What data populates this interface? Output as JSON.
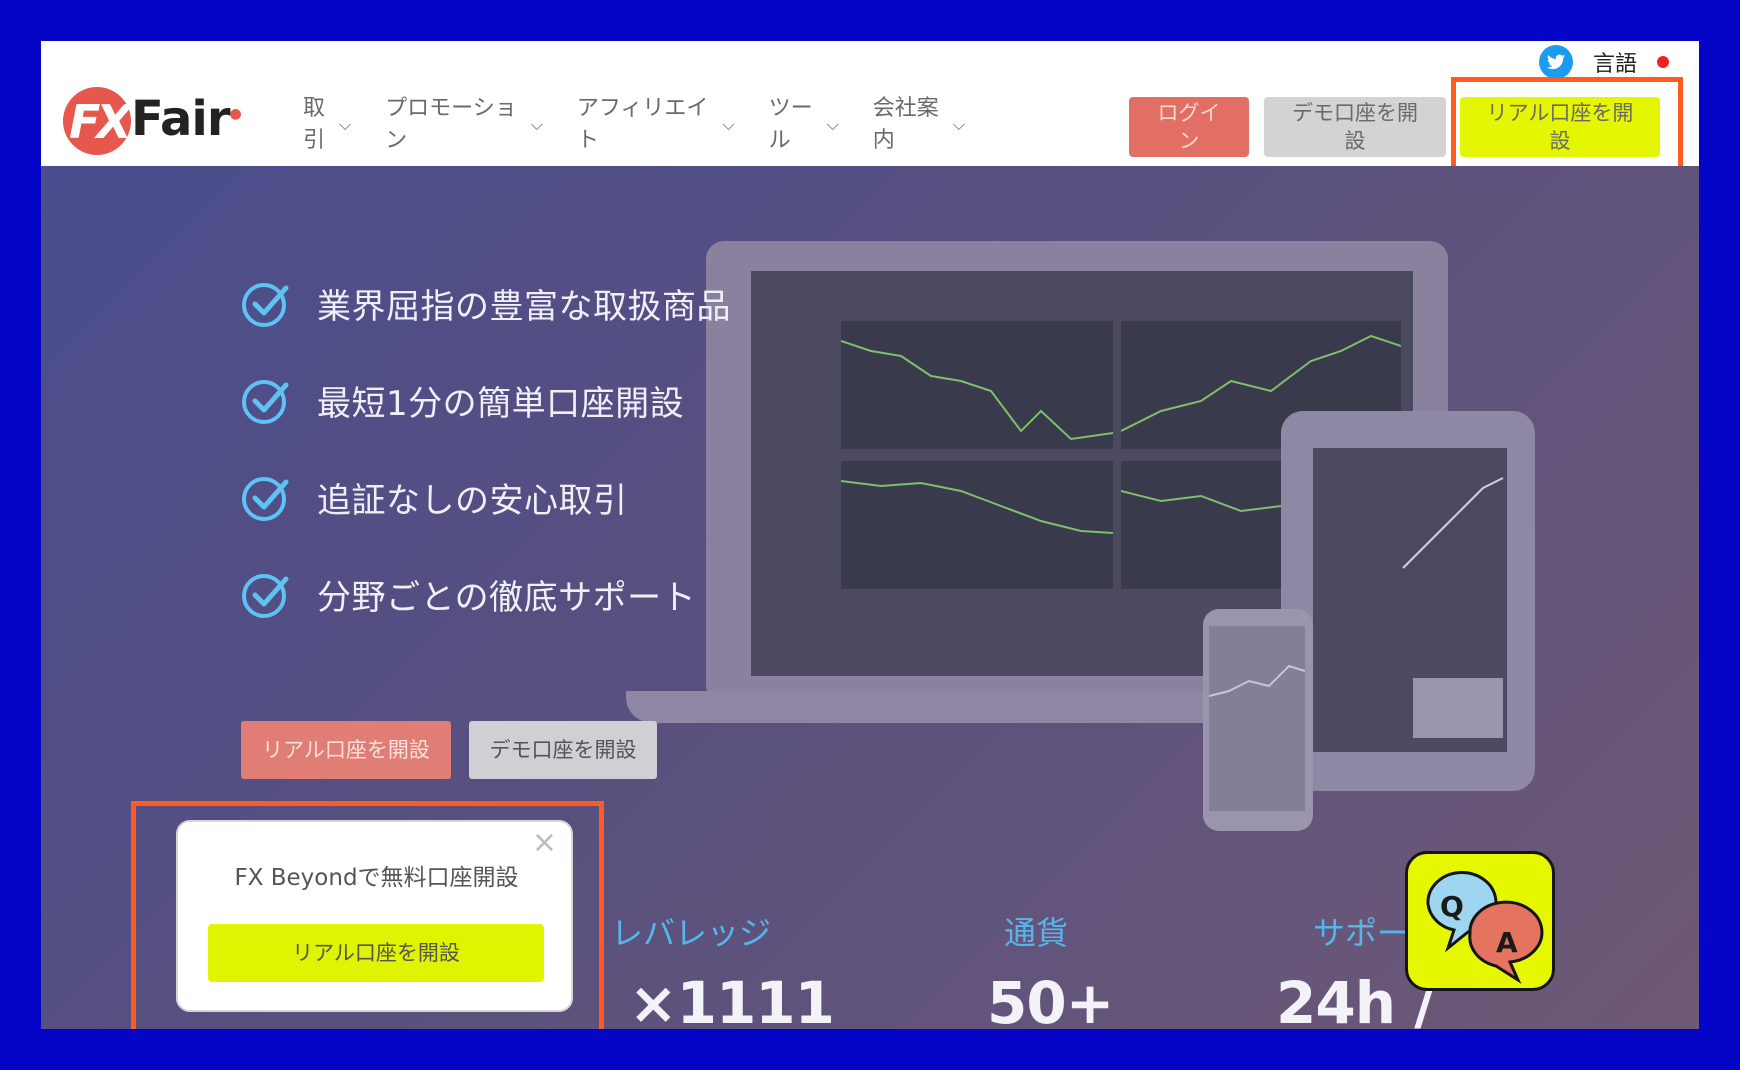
{
  "logo": {
    "fx": "FX",
    "name": "Fair"
  },
  "topbar": {
    "language_label": "言語"
  },
  "nav": {
    "items": [
      {
        "label": "取\n引"
      },
      {
        "label": "プロモーショ\nン"
      },
      {
        "label": "アフィリエイ\nト"
      },
      {
        "label": "ツー\nル"
      },
      {
        "label": "会社案\n内"
      }
    ]
  },
  "header_buttons": {
    "login": "ログイ\nン",
    "demo": "デモ口座を開\n設",
    "real": "リアル口座を開\n設"
  },
  "hero": {
    "features": [
      "業界屈指の豊富な取扱商品",
      "最短1分の簡単口座開設",
      "追証なしの安心取引",
      "分野ごとの徹底サポート"
    ],
    "cta_real": "リアル口座を開設",
    "cta_demo": "デモ口座を開設"
  },
  "stats": [
    {
      "label": "レバレッジ",
      "value": "×1111"
    },
    {
      "label": "通貨",
      "value": "50+"
    },
    {
      "label": "サポー",
      "value": "24h /"
    }
  ],
  "popup": {
    "title": "FX Beyondで無料口座開設",
    "button": "リアル口座を開設",
    "close": "×"
  },
  "qa_badge": {
    "q": "Q",
    "a": "A"
  },
  "colors": {
    "frame_bg": "#0505c8",
    "highlight": "#ff5a1f",
    "accent_yellow": "#e4f600",
    "login_red": "#e26f63",
    "stat_blue": "#55b6ec"
  }
}
